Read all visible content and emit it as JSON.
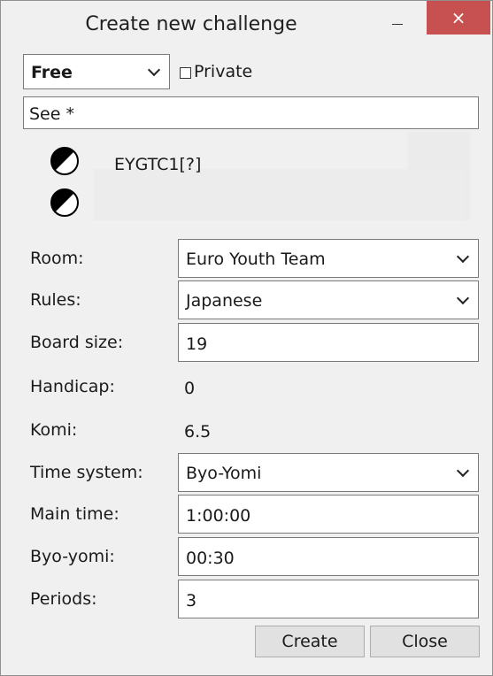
{
  "window": {
    "title": "Create new challenge",
    "minimize_glyph": "",
    "close_glyph": "×"
  },
  "top": {
    "type_select": "Free",
    "private_label": "Private",
    "private_checked": false,
    "description": "See *"
  },
  "players": {
    "name": "EYGTC1[?]",
    "icon1": "black-white-stone-icon",
    "icon2": "black-white-stone-icon"
  },
  "form": {
    "room_label": "Room:",
    "room_value": "Euro Youth Team",
    "rules_label": "Rules:",
    "rules_value": "Japanese",
    "board_size_label": "Board size:",
    "board_size_value": "19",
    "handicap_label": "Handicap:",
    "handicap_value": "0",
    "komi_label": "Komi:",
    "komi_value": "6.5",
    "time_system_label": "Time system:",
    "time_system_value": "Byo-Yomi",
    "main_time_label": "Main time:",
    "main_time_value": "1:00:00",
    "byo_yomi_label": "Byo-yomi:",
    "byo_yomi_value": "00:30",
    "periods_label": "Periods:",
    "periods_value": "3"
  },
  "buttons": {
    "create": "Create",
    "close": "Close"
  }
}
